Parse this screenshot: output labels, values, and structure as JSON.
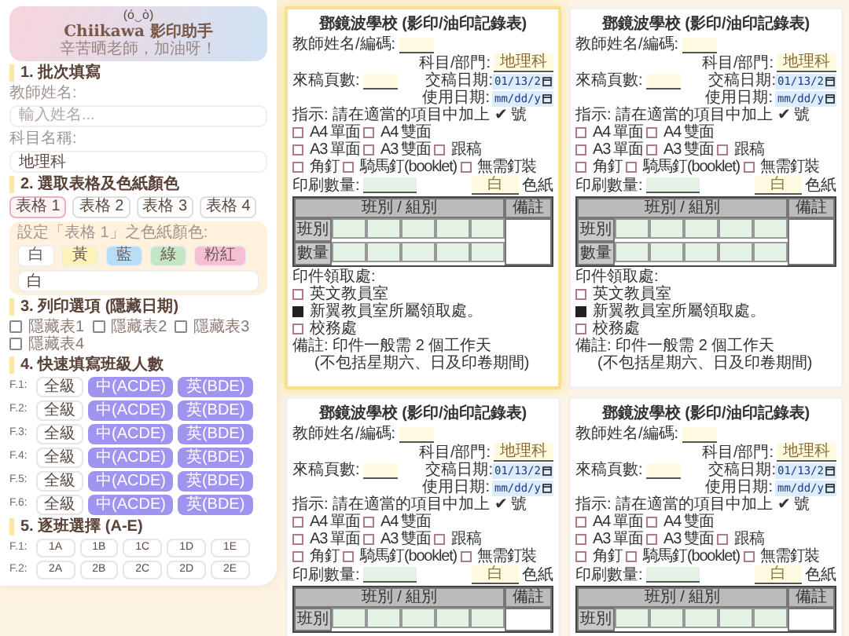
{
  "sidebar": {
    "header": {
      "emoticon": "(ó‿ò)",
      "title": "Chiikawa 影印助手",
      "subtitle": "辛苦晒老師，加油呀！"
    },
    "section_1": {
      "title": "1. 批次填寫",
      "fields": [
        {
          "label": "教師姓名:",
          "placeholder": "輸入姓名..."
        },
        {
          "label": "科目名稱:",
          "value": "地理科"
        }
      ]
    },
    "section_2": {
      "title": "2. 選取表格及色紙顏色",
      "tabs": [
        {
          "label": "表格 1",
          "selected": true
        },
        {
          "label": "表格 2",
          "selected": false
        },
        {
          "label": "表格 3",
          "selected": false
        },
        {
          "label": "表格 4",
          "selected": false
        }
      ],
      "color_box": {
        "prompt": "設定「表格 1」之色紙顏色:",
        "swatches": [
          {
            "label": "白",
            "color": "#ffffff"
          },
          {
            "label": "黃",
            "color": "#fdf3b8"
          },
          {
            "label": "藍",
            "color": "#b9dcf7"
          },
          {
            "label": "綠",
            "color": "#c4e6c4"
          },
          {
            "label": "粉紅",
            "color": "#f6bfd6"
          }
        ],
        "value": "白"
      }
    },
    "section_3": {
      "title": "3. 列印選項 (隱藏日期)",
      "checkboxes": [
        {
          "label": "隱藏表1",
          "checked": false
        },
        {
          "label": "隱藏表2",
          "checked": false
        },
        {
          "label": "隱藏表3",
          "checked": false
        },
        {
          "label": "隱藏表4",
          "checked": false
        }
      ]
    },
    "section_4": {
      "title": "4. 快速填寫班級人數",
      "rows": [
        {
          "label": "F.1:",
          "buttons": [
            {
              "label": "全級",
              "kind": "outline"
            },
            {
              "label": "中(ACDE)",
              "kind": "filled"
            },
            {
              "label": "英(BDE)",
              "kind": "filled"
            }
          ]
        },
        {
          "label": "F.2:",
          "buttons": [
            {
              "label": "全級",
              "kind": "outline"
            },
            {
              "label": "中(ACDE)",
              "kind": "filled"
            },
            {
              "label": "英(BDE)",
              "kind": "filled"
            }
          ]
        },
        {
          "label": "F.3:",
          "buttons": [
            {
              "label": "全級",
              "kind": "outline"
            },
            {
              "label": "中(ACDE)",
              "kind": "filled"
            },
            {
              "label": "英(BDE)",
              "kind": "filled"
            }
          ]
        },
        {
          "label": "F.4:",
          "buttons": [
            {
              "label": "全級",
              "kind": "outline"
            },
            {
              "label": "中(ACDE)",
              "kind": "filled"
            },
            {
              "label": "英(BDE)",
              "kind": "filled"
            }
          ]
        },
        {
          "label": "F.5:",
          "buttons": [
            {
              "label": "全級",
              "kind": "outline"
            },
            {
              "label": "中(ACDE)",
              "kind": "filled"
            },
            {
              "label": "英(BDE)",
              "kind": "filled"
            }
          ]
        },
        {
          "label": "F.6:",
          "buttons": [
            {
              "label": "全級",
              "kind": "outline"
            },
            {
              "label": "中(ACDE)",
              "kind": "filled"
            },
            {
              "label": "英(BDE)",
              "kind": "filled"
            }
          ]
        }
      ]
    },
    "section_5": {
      "title": "5. 逐班選擇 (A-E)",
      "rows": [
        {
          "label": "F.1:",
          "buttons": [
            "1A",
            "1B",
            "1C",
            "1D",
            "1E"
          ]
        },
        {
          "label": "F.2:",
          "buttons": [
            "2A",
            "2B",
            "2C",
            "2D",
            "2E"
          ]
        }
      ]
    }
  },
  "forms": [
    {
      "selected": true,
      "title": "鄧鏡波學校 (影印/油印記錄表)",
      "teacher_label": "教師姓名/編碼:",
      "subject_label": "科目/部門:",
      "subject_value": "地理科",
      "pages_label": "來稿頁數:",
      "submit_date_label": "交稿日期:",
      "submit_date_value": "01/13/2",
      "use_date_label": "使用日期:",
      "use_date_value": "mm/dd/y",
      "instruction": "指示: 請在適當的項目中加上 ✔ 號",
      "options": [
        [
          {
            "label": "A4 單面",
            "checked": false
          },
          {
            "label": "A4 雙面",
            "checked": false
          }
        ],
        [
          {
            "label": "A3 單面",
            "checked": false
          },
          {
            "label": "A3 雙面",
            "checked": false
          },
          {
            "label": "跟稿",
            "checked": false
          }
        ],
        [
          {
            "label": "角釘",
            "checked": false
          },
          {
            "label": "騎馬釘(booklet)",
            "checked": false
          },
          {
            "label": "無需釘裝",
            "checked": false
          }
        ]
      ],
      "print_count_label": "印刷數量:",
      "paper_value": "白",
      "paper_label": "色紙",
      "table": {
        "header": "班別 / 組別",
        "remarks": "備註",
        "rows": [
          "班別",
          "數量"
        ]
      },
      "pickup_label": "印件領取處:",
      "pickup": [
        {
          "label": "英文教員室",
          "checked": false
        },
        {
          "label": "新翼教員室所屬領取處。",
          "checked": true
        },
        {
          "label": "校務處",
          "checked": false
        }
      ],
      "notes": [
        "備註: 印件一般需 2 個工作天",
        "(不包括星期六、日及印卷期間)"
      ]
    },
    {
      "selected": false,
      "title": "鄧鏡波學校 (影印/油印記錄表)",
      "teacher_label": "教師姓名/編碼:",
      "subject_label": "科目/部門:",
      "subject_value": "地理科",
      "pages_label": "來稿頁數:",
      "submit_date_label": "交稿日期:",
      "submit_date_value": "01/13/2",
      "use_date_label": "使用日期:",
      "use_date_value": "mm/dd/y",
      "instruction": "指示: 請在適當的項目中加上 ✔ 號",
      "options": [
        [
          {
            "label": "A4 單面",
            "checked": false
          },
          {
            "label": "A4 雙面",
            "checked": false
          }
        ],
        [
          {
            "label": "A3 單面",
            "checked": false
          },
          {
            "label": "A3 雙面",
            "checked": false
          },
          {
            "label": "跟稿",
            "checked": false
          }
        ],
        [
          {
            "label": "角釘",
            "checked": false
          },
          {
            "label": "騎馬釘(booklet)",
            "checked": false
          },
          {
            "label": "無需釘裝",
            "checked": false
          }
        ]
      ],
      "print_count_label": "印刷數量:",
      "paper_value": "白",
      "paper_label": "色紙",
      "table": {
        "header": "班別 / 組別",
        "remarks": "備註",
        "rows": [
          "班別",
          "數量"
        ]
      },
      "pickup_label": "印件領取處:",
      "pickup": [
        {
          "label": "英文教員室",
          "checked": false
        },
        {
          "label": "新翼教員室所屬領取處。",
          "checked": true
        },
        {
          "label": "校務處",
          "checked": false
        }
      ],
      "notes": [
        "備註: 印件一般需 2 個工作天",
        "(不包括星期六、日及印卷期間)"
      ]
    },
    {
      "selected": false,
      "title": "鄧鏡波學校 (影印/油印記錄表)",
      "teacher_label": "教師姓名/編碼:",
      "subject_label": "科目/部門:",
      "subject_value": "地理科",
      "pages_label": "來稿頁數:",
      "submit_date_label": "交稿日期:",
      "submit_date_value": "01/13/2",
      "use_date_label": "使用日期:",
      "use_date_value": "mm/dd/y",
      "instruction": "指示: 請在適當的項目中加上 ✔ 號",
      "options": [
        [
          {
            "label": "A4 單面",
            "checked": false
          },
          {
            "label": "A4 雙面",
            "checked": false
          }
        ],
        [
          {
            "label": "A3 單面",
            "checked": false
          },
          {
            "label": "A3 雙面",
            "checked": false
          },
          {
            "label": "跟稿",
            "checked": false
          }
        ],
        [
          {
            "label": "角釘",
            "checked": false
          },
          {
            "label": "騎馬釘(booklet)",
            "checked": false
          },
          {
            "label": "無需釘裝",
            "checked": false
          }
        ]
      ],
      "print_count_label": "印刷數量:",
      "paper_value": "白",
      "paper_label": "色紙",
      "table": {
        "header": "班別 / 組別",
        "remarks": "備註",
        "rows": [
          "班別"
        ]
      }
    },
    {
      "selected": false,
      "title": "鄧鏡波學校 (影印/油印記錄表)",
      "teacher_label": "教師姓名/編碼:",
      "subject_label": "科目/部門:",
      "subject_value": "地理科",
      "pages_label": "來稿頁數:",
      "submit_date_label": "交稿日期:",
      "submit_date_value": "01/13/2",
      "use_date_label": "使用日期:",
      "use_date_value": "mm/dd/y",
      "instruction": "指示: 請在適當的項目中加上 ✔ 號",
      "options": [
        [
          {
            "label": "A4 單面",
            "checked": false
          },
          {
            "label": "A4 雙面",
            "checked": false
          }
        ],
        [
          {
            "label": "A3 單面",
            "checked": false
          },
          {
            "label": "A3 雙面",
            "checked": false
          },
          {
            "label": "跟稿",
            "checked": false
          }
        ],
        [
          {
            "label": "角釘",
            "checked": false
          },
          {
            "label": "騎馬釘(booklet)",
            "checked": false
          },
          {
            "label": "無需釘裝",
            "checked": false
          }
        ]
      ],
      "print_count_label": "印刷數量:",
      "paper_value": "白",
      "paper_label": "色紙",
      "table": {
        "header": "班別 / 組別",
        "remarks": "備註",
        "rows": [
          "班別"
        ]
      }
    }
  ]
}
